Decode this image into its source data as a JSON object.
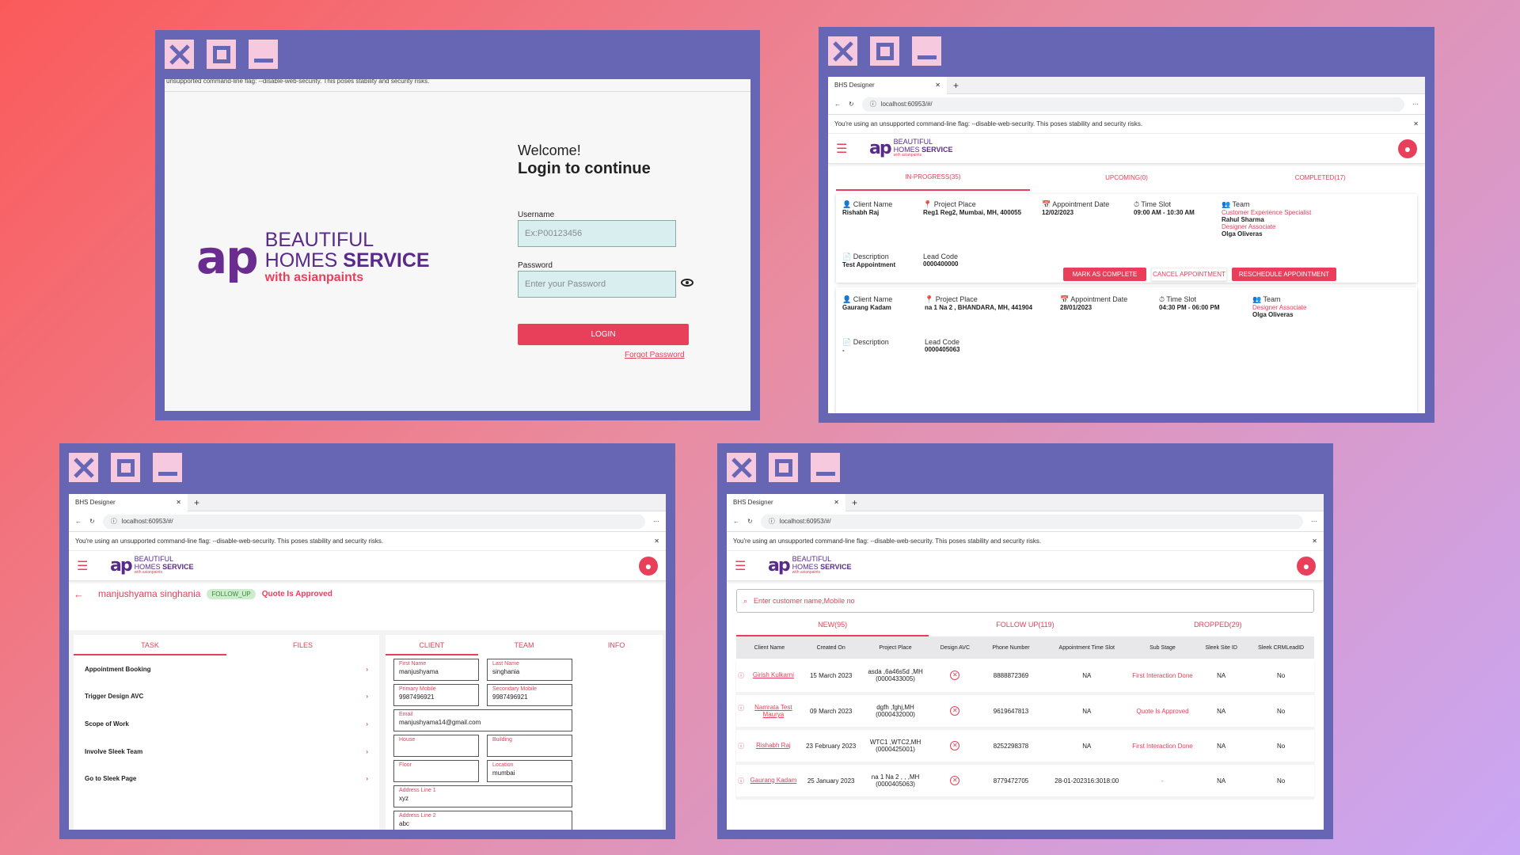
{
  "colors": {
    "accent": "#e8405b",
    "window": "#6766b4",
    "brand": "#5a2a8a"
  },
  "brand": {
    "mark": "ap",
    "line1": "BEAUTIFUL",
    "line2_a": "HOMES",
    "line2_b": "SERVICE",
    "line3": "with asianpaints"
  },
  "browser": {
    "tab_title": "BHS Designer",
    "url": "localhost:60953/#/",
    "warning": "You're using an unsupported command-line flag: --disable-web-security. This poses stability and security risks.",
    "warning_truncated": "unsupported command-line flag: --disable-web-security. This poses stability and security risks."
  },
  "login": {
    "welcome": "Welcome!",
    "title": "Login to continue",
    "username_label": "Username",
    "username_placeholder": "Ex:P00123456",
    "password_label": "Password",
    "password_placeholder": "Enter your Password",
    "login_button": "LOGIN",
    "forgot": "Forgot Password"
  },
  "appointments": {
    "tabs": [
      "IN-PROGRESS(35)",
      "UPCOMING(0)",
      "COMPLETED(17)"
    ],
    "labels": {
      "client": "Client Name",
      "place": "Project Place",
      "date": "Appointment Date",
      "slot": "Time Slot",
      "team": "Team",
      "desc": "Description",
      "lead": "Lead Code"
    },
    "buttons": {
      "complete": "MARK AS COMPLETE",
      "cancel": "CANCEL APPOINTMENT",
      "reschedule": "RESCHEDULE APPOINTMENT"
    },
    "cards": [
      {
        "client": "Rishabh Raj",
        "place": "Reg1 Reg2, Mumbai, MH, 400055",
        "date": "12/02/2023",
        "slot": "09:00 AM - 10:30 AM",
        "team": [
          {
            "role": "Customer Experience Specialist",
            "name": "Rahul Sharma"
          },
          {
            "role": "Designer Associate",
            "name": "Olga Oliveras"
          }
        ],
        "desc": "Test Appointment",
        "lead": "0000400000"
      },
      {
        "client": "Gaurang Kadam",
        "place": "na 1 Na 2  , BHANDARA, MH, 441904",
        "date": "28/01/2023",
        "slot": "04:30 PM - 06:00 PM",
        "team": [
          {
            "role": "Designer Associate",
            "name": "Olga Oliveras"
          }
        ],
        "desc": "-",
        "lead": "0000405063"
      }
    ]
  },
  "detail": {
    "client_name": "manjushyama singhania",
    "badge": "FOLLOW_UP",
    "status": "Quote Is Approved",
    "left_tabs": [
      "TASK",
      "FILES"
    ],
    "tasks": [
      "Appointment Booking",
      "Trigger Design AVC",
      "Scope of Work",
      "Involve Sleek Team",
      "Go to Sleek Page"
    ],
    "right_tabs": [
      "CLIENT",
      "TEAM",
      "INFO"
    ],
    "fields": {
      "first_name": {
        "label": "First Name",
        "value": "manjushyama"
      },
      "last_name": {
        "label": "Last Name",
        "value": "singhania"
      },
      "primary_mobile": {
        "label": "Primary Mobile",
        "value": "9987496921"
      },
      "secondary_mobile": {
        "label": "Secondary Mobile",
        "value": "9987496921"
      },
      "email": {
        "label": "Email",
        "value": "manjushyama14@gmail.com"
      },
      "house": {
        "label": "House",
        "value": ""
      },
      "building": {
        "label": "Building",
        "value": ""
      },
      "floor": {
        "label": "Floor",
        "value": ""
      },
      "location": {
        "label": "Location",
        "value": "mumbai"
      },
      "address1": {
        "label": "Address Line 1",
        "value": "xyz"
      },
      "address2": {
        "label": "Address Line 2",
        "value": "abc"
      }
    }
  },
  "leads": {
    "search_placeholder": "Enter customer name,Mobile no",
    "tabs": [
      "NEW(95)",
      "FOLLOW UP(119)",
      "DROPPED(29)"
    ],
    "headers": [
      "Client Name",
      "Created On",
      "Project Place",
      "Design AVC",
      "Phone Number",
      "Appointment Time Slot",
      "Sub Stage",
      "Sleek Site ID",
      "Sleek CRMLeadID"
    ],
    "rows": [
      {
        "name": "Girish Kulkarni",
        "created": "15 March 2023",
        "place": "asda ,6a46s5d ,MH (0000433005)",
        "phone": "8888872369",
        "slot": "NA",
        "stage": "First Interaction Done",
        "site": "NA",
        "crm": "No"
      },
      {
        "name": "Namrata Test Maurya",
        "created": "09 March 2023",
        "place": "dgfh ,fghj,MH (0000432000)",
        "phone": "9619647813",
        "slot": "NA",
        "stage": "Quote Is Approved",
        "site": "NA",
        "crm": "No"
      },
      {
        "name": "Rishabh Raj",
        "created": "23 February 2023",
        "place": "WTC1 ,WTC2,MH (0000425001)",
        "phone": "8252298378",
        "slot": "NA",
        "stage": "First Interaction Done",
        "site": "NA",
        "crm": "No"
      },
      {
        "name": "Gaurang Kadam",
        "created": "25 January 2023",
        "place": "na 1 Na 2 , , ,MH (0000405063)",
        "phone": "8779472705",
        "slot": "28-01-202316:3018:00",
        "stage": "-",
        "site": "NA",
        "crm": "No"
      }
    ]
  }
}
